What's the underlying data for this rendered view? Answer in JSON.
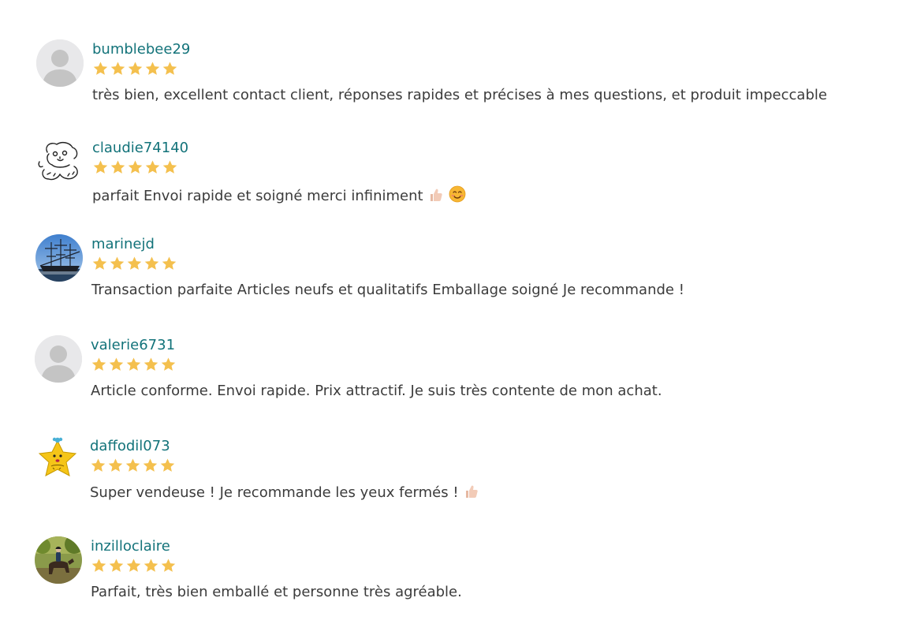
{
  "reviews": [
    {
      "username": "bumblebee29",
      "rating": 5,
      "avatar": "default-user-icon",
      "comment": "très bien, excellent contact client, réponses rapides et précises à mes questions, et produit impeccable",
      "emojis": []
    },
    {
      "username": "claudie74140",
      "rating": 5,
      "avatar": "lion-cub-drawing",
      "comment": "parfait Envoi rapide et soigné merci infiniment",
      "emojis": [
        "thumbs-up-icon",
        "smiling-face-icon"
      ]
    },
    {
      "username": "marinejd",
      "rating": 5,
      "avatar": "tall-ship-photo",
      "comment": "Transaction parfaite Articles neufs et qualitatifs Emballage soigné Je recommande !",
      "emojis": []
    },
    {
      "username": "valerie6731",
      "rating": 5,
      "avatar": "default-user-icon",
      "comment": "Article conforme. Envoi rapide. Prix attractif. Je suis très contente de mon achat.",
      "emojis": []
    },
    {
      "username": "daffodil073",
      "rating": 5,
      "avatar": "yellow-star-character",
      "comment": "Super vendeuse ! Je recommande les yeux fermés !",
      "emojis": [
        "thumbs-up-icon"
      ]
    },
    {
      "username": "inzilloclaire",
      "rating": 5,
      "avatar": "horse-rider-photo",
      "comment": "Parfait, très bien emballé et personne très agréable.",
      "emojis": []
    }
  ],
  "colors": {
    "username": "#13737a",
    "star": "#f4c04e",
    "text": "#3b3b3b",
    "avatar_bg": "#e6e6e6"
  }
}
